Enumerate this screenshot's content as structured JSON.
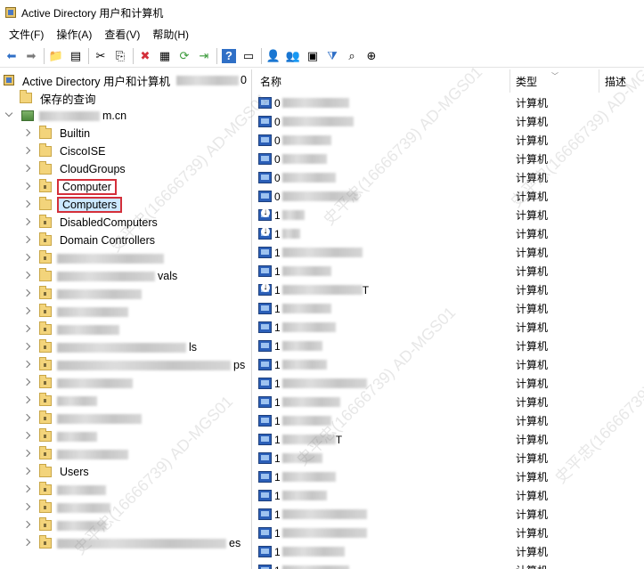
{
  "window": {
    "title": "Active Directory 用户和计算机"
  },
  "menu": [
    "文件(F)",
    "操作(A)",
    "查看(V)",
    "帮助(H)"
  ],
  "toolbar_icons": [
    "back-icon",
    "forward-icon",
    "sep",
    "up-folder-icon",
    "show-tree-icon",
    "sep",
    "cut-icon",
    "copy-icon",
    "sep",
    "delete-icon",
    "properties-icon",
    "refresh-icon",
    "export-icon",
    "sep",
    "help-icon",
    "console-icon",
    "sep",
    "new-user-icon",
    "new-group-icon",
    "new-ou-icon",
    "filter-icon",
    "find-icon",
    "add-to-group-icon"
  ],
  "tree": {
    "root_label": "Active Directory 用户和计算机",
    "saved_queries": "保存的查询",
    "domain_suffix": "m.cn",
    "items": [
      {
        "label": "Builtin",
        "type": "folder"
      },
      {
        "label": "CiscoISE",
        "type": "folder"
      },
      {
        "label": "CloudGroups",
        "type": "folder"
      },
      {
        "label": "Computer",
        "type": "ou",
        "boxed": true
      },
      {
        "label": "Computers",
        "type": "folder",
        "boxed": true,
        "selected": true
      },
      {
        "label": "DisabledComputers",
        "type": "ou"
      },
      {
        "label": "Domain Controllers",
        "type": "ou"
      },
      {
        "label": "",
        "type": "ou",
        "blur": 120
      },
      {
        "label": "vals",
        "type": "folder",
        "blur": 110
      },
      {
        "label": "",
        "type": "ou",
        "blur": 95
      },
      {
        "label": "",
        "type": "ou",
        "blur": 80
      },
      {
        "label": "",
        "type": "ou",
        "blur": 70
      },
      {
        "label": "ls",
        "type": "ou",
        "blur": 145
      },
      {
        "label": "ps",
        "type": "ou",
        "blur": 195
      },
      {
        "label": "",
        "type": "ou",
        "blur": 85
      },
      {
        "label": "",
        "type": "ou",
        "blur": 45
      },
      {
        "label": "",
        "type": "ou",
        "blur": 95
      },
      {
        "label": "",
        "type": "ou",
        "blur": 45
      },
      {
        "label": "",
        "type": "ou",
        "blur": 80
      },
      {
        "label": "Users",
        "type": "folder"
      },
      {
        "label": "",
        "type": "ou",
        "blur": 55
      },
      {
        "label": "",
        "type": "ou",
        "blur": 60
      },
      {
        "label": "",
        "type": "ou",
        "blur": 55
      },
      {
        "label": "es",
        "type": "ou",
        "blur": 190
      }
    ]
  },
  "list": {
    "columns": [
      "名称",
      "类型",
      "描述"
    ],
    "type_value": "计算机",
    "rows": [
      {
        "prefix": "0",
        "blur": 75,
        "disabled": false
      },
      {
        "prefix": "0",
        "blur": 80,
        "disabled": false
      },
      {
        "prefix": "0",
        "blur": 55,
        "disabled": false
      },
      {
        "prefix": "0",
        "blur": 50,
        "disabled": false
      },
      {
        "prefix": "0",
        "blur": 60,
        "disabled": false
      },
      {
        "prefix": "0",
        "blur": 85,
        "disabled": false
      },
      {
        "prefix": "1",
        "blur": 25,
        "disabled": true
      },
      {
        "prefix": "1",
        "blur": 20,
        "disabled": true
      },
      {
        "prefix": "1",
        "blur": 90,
        "disabled": false
      },
      {
        "prefix": "1",
        "blur": 55,
        "disabled": false
      },
      {
        "prefix": "1",
        "blur": 90,
        "disabled": true,
        "suffix": "T"
      },
      {
        "prefix": "1",
        "blur": 55,
        "disabled": false
      },
      {
        "prefix": "1",
        "blur": 60,
        "disabled": false
      },
      {
        "prefix": "1",
        "blur": 45,
        "disabled": false
      },
      {
        "prefix": "1",
        "blur": 50,
        "disabled": false
      },
      {
        "prefix": "1",
        "blur": 95,
        "disabled": false
      },
      {
        "prefix": "1",
        "blur": 65,
        "disabled": false
      },
      {
        "prefix": "1",
        "blur": 55,
        "disabled": false
      },
      {
        "prefix": "1",
        "blur": 60,
        "disabled": false,
        "suffix": "T"
      },
      {
        "prefix": "1",
        "blur": 45,
        "disabled": false
      },
      {
        "prefix": "1",
        "blur": 60,
        "disabled": false
      },
      {
        "prefix": "1",
        "blur": 50,
        "disabled": false
      },
      {
        "prefix": "1",
        "blur": 95,
        "disabled": false
      },
      {
        "prefix": "1",
        "blur": 95,
        "disabled": false
      },
      {
        "prefix": "1",
        "blur": 70,
        "disabled": false
      },
      {
        "prefix": "1",
        "blur": 75,
        "disabled": false
      }
    ]
  },
  "watermark": "史平忠(16666739) AD-MGS01"
}
